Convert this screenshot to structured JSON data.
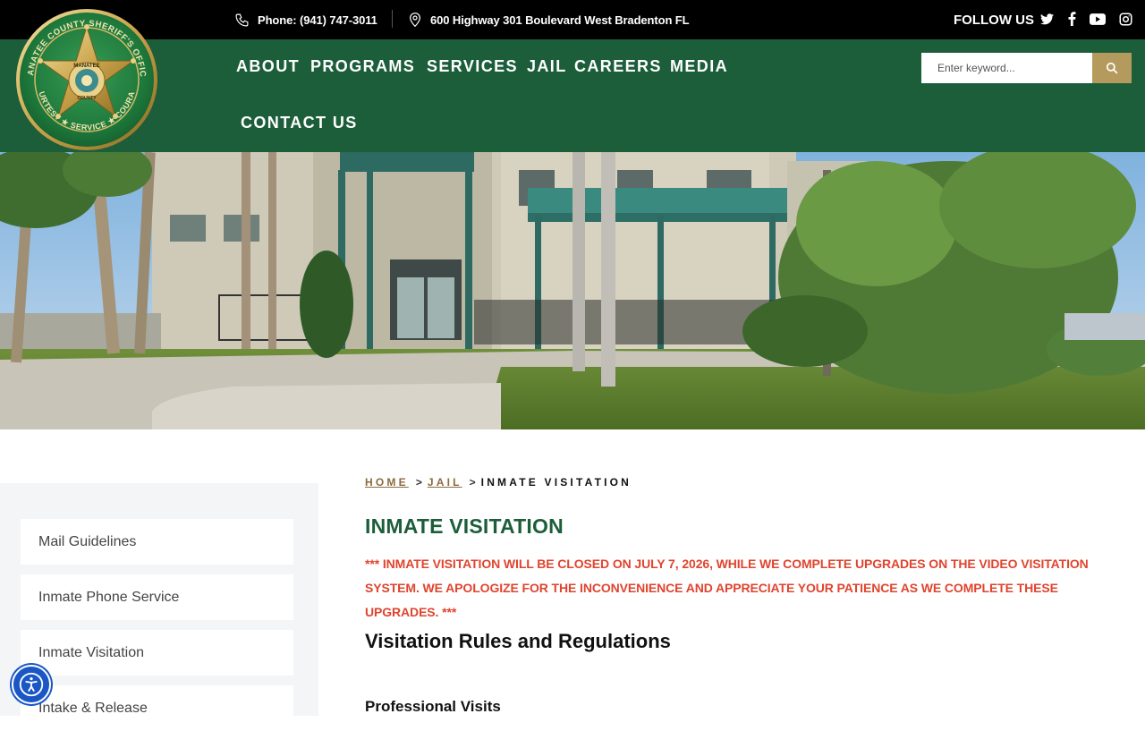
{
  "topbar": {
    "phone": "Phone: (941) 747-3011",
    "address": "600 Highway 301 Boulevard West Bradenton FL",
    "follow_label": "FOLLOW US",
    "social_icons": [
      "twitter-icon",
      "facebook-icon",
      "youtube-icon",
      "instagram-icon"
    ]
  },
  "logo": {
    "top_text": "MANATEE COUNTY SHERIFF'S OFFICE",
    "center_top": "MANATEE",
    "center_bottom": "COUNTY",
    "bottom_text": "COURTESY ★ SERVICE ★ COURAGE"
  },
  "nav": {
    "items": [
      "ABOUT",
      "PROGRAMS",
      "SERVICES",
      "JAIL",
      "CAREERS",
      "MEDIA",
      "CONTACT US"
    ]
  },
  "search": {
    "placeholder": "Enter keyword..."
  },
  "breadcrumb": {
    "home": "HOME",
    "jail": "JAIL",
    "separator": ">",
    "current": "INMATE VISITATION"
  },
  "sidebar": {
    "items": [
      "Mail Guidelines",
      "Inmate Phone Service",
      "Inmate Visitation",
      "Intake & Release"
    ]
  },
  "content": {
    "title": "INMATE VISITATION",
    "notice": "*** INMATE VISITATION WILL BE CLOSED ON JULY 7, 2026, WHILE WE COMPLETE UPGRADES ON THE VIDEO VISITATION SYSTEM. WE APOLOGIZE FOR THE INCONVENIENCE AND APPRECIATE YOUR PATIENCE AS WE COMPLETE THESE UPGRADES. ***",
    "heading": "Visitation Rules and Regulations",
    "subheading": "Professional Visits"
  },
  "colors": {
    "brand_green": "#1c5e3a",
    "gold": "#b49a5c",
    "alert_red": "#e0442e",
    "link_brown": "#8b6a3e",
    "a11y_blue": "#1a57c5"
  }
}
